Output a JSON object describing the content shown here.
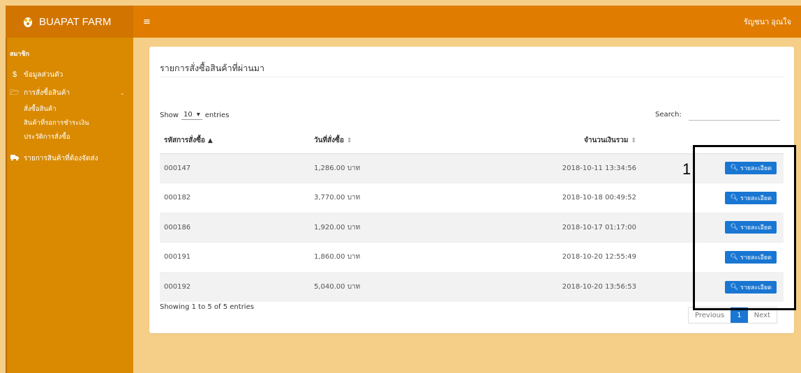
{
  "brand": "BUAPAT FARM",
  "user_name": "รัญชนา อุณใจ",
  "sidebar": {
    "header": "สมาชิก",
    "items": [
      {
        "icon": "dollar-icon",
        "glyph": "$",
        "label": "ข้อมูลส่วนตัว"
      },
      {
        "icon": "folder-open-icon",
        "glyph": "🗁",
        "label": "การสั่งซื้อสินค้า"
      }
    ],
    "subitems": [
      "สั่งซื้อสินค้า",
      "สินค้าที่รอการชำระเงิน",
      "ประวัติการสั่งซื้อ"
    ],
    "extra": {
      "icon": "truck-icon",
      "label": "รายการสินค้าที่ต้องจัดส่ง"
    }
  },
  "card": {
    "title": "รายการสั่งซื้อสินค้าที่ผ่านมา"
  },
  "length": {
    "show": "Show",
    "value": "10",
    "entries": "entries"
  },
  "search": {
    "label": "Search:",
    "value": ""
  },
  "table": {
    "headers": [
      "รหัสการสั่งซื้อ",
      "วันที่สั่งซื้อ",
      "จำนวนเงินรวม"
    ],
    "rows": [
      {
        "id": "000147",
        "amount": "1,286.00 บาท",
        "date": "2018-10-11 13:34:56"
      },
      {
        "id": "000182",
        "amount": "3,770.00 บาท",
        "date": "2018-10-18 00:49:52"
      },
      {
        "id": "000186",
        "amount": "1,920.00 บาท",
        "date": "2018-10-17 01:17:00"
      },
      {
        "id": "000191",
        "amount": "1,860.00 บาท",
        "date": "2018-10-20 12:55:49"
      },
      {
        "id": "000192",
        "amount": "5,040.00 บาท",
        "date": "2018-10-20 13:56:53"
      }
    ],
    "detail_label": "รายละเอียด"
  },
  "info": "Showing 1 to 5 of 5 entries",
  "pagination": {
    "previous": "Previous",
    "current": "1",
    "next": "Next"
  },
  "annotation": {
    "number": "1"
  },
  "colors": {
    "header": "#e07d00",
    "sidebar": "#d98a00",
    "accent": "#1976d2",
    "background": "#f5cf87"
  }
}
